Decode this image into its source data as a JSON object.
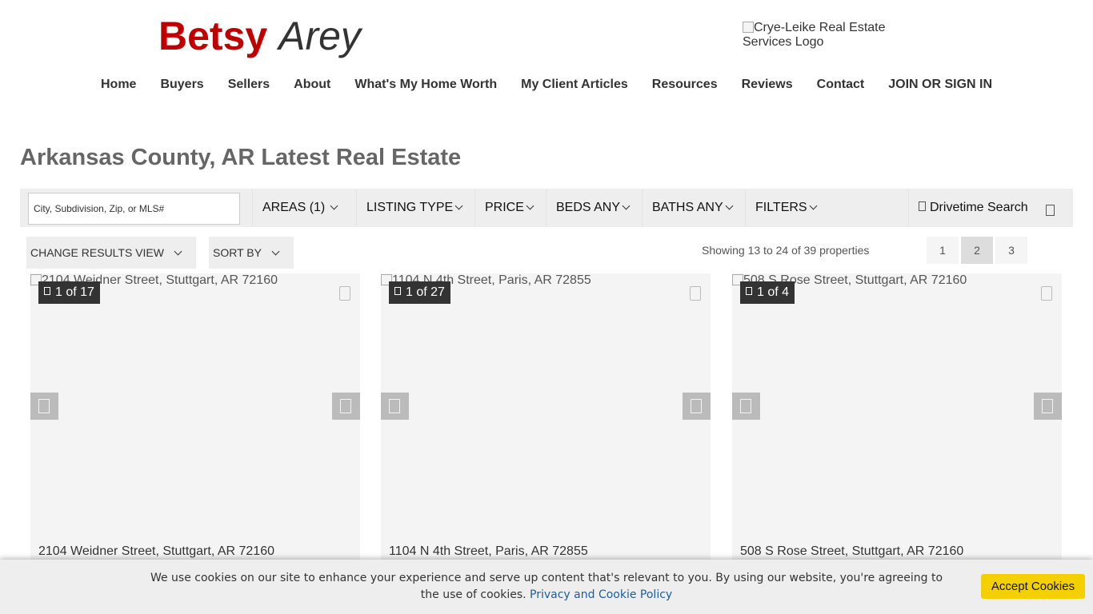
{
  "header": {
    "logo_first": "Betsy",
    "logo_last": "Arey",
    "partner_logo_alt": "Crye-Leike Real Estate Services Logo"
  },
  "nav": [
    "Home",
    "Buyers",
    "Sellers",
    "About",
    "What's My Home Worth",
    "My Client Articles",
    "Resources",
    "Reviews",
    "Contact",
    "JOIN OR SIGN IN"
  ],
  "page_title": "Arkansas County, AR Latest Real Estate",
  "search": {
    "placeholder": "City, Subdivision, Zip, or MLS#",
    "filters": [
      "AREAS (1)",
      "LISTING TYPE",
      "PRICE",
      "BEDS ANY",
      "BATHS ANY",
      "FILTERS"
    ],
    "drivetime": "Drivetime Search",
    "map_icon": "map-icon"
  },
  "toolbar": {
    "change_view": "CHANGE RESULTS VIEW",
    "sort_by": "SORT BY",
    "showing": "Showing 13 to 24 of 39 properties",
    "pages": [
      "1",
      "2",
      "3"
    ],
    "current_page": "2"
  },
  "listings": [
    {
      "image_alt": "2104 Weidner Street, Stuttgart, AR 72160",
      "photo_count": "1 of 17",
      "address": "2104 Weidner Street, Stuttgart, AR 72160"
    },
    {
      "image_alt": "1104 N 4th Street, Paris, AR 72855",
      "photo_count": "1 of 27",
      "address": "1104 N 4th Street, Paris, AR 72855"
    },
    {
      "image_alt": "508 S Rose Street, Stuttgart, AR 72160",
      "photo_count": "1 of 4",
      "address": "508 S Rose Street, Stuttgart, AR 72160"
    }
  ],
  "cookie": {
    "message": "We use cookies on our site to enhance your experience and serve up content that's relevant to you. By using our website, you're agreeing to the use of cookies.",
    "policy_link": "Privacy and Cookie Policy",
    "accept": "Accept Cookies"
  },
  "colors": {
    "logo_red": "#c00000",
    "accept_yellow": "#f5d000",
    "link_blue": "#1a5e9c"
  }
}
